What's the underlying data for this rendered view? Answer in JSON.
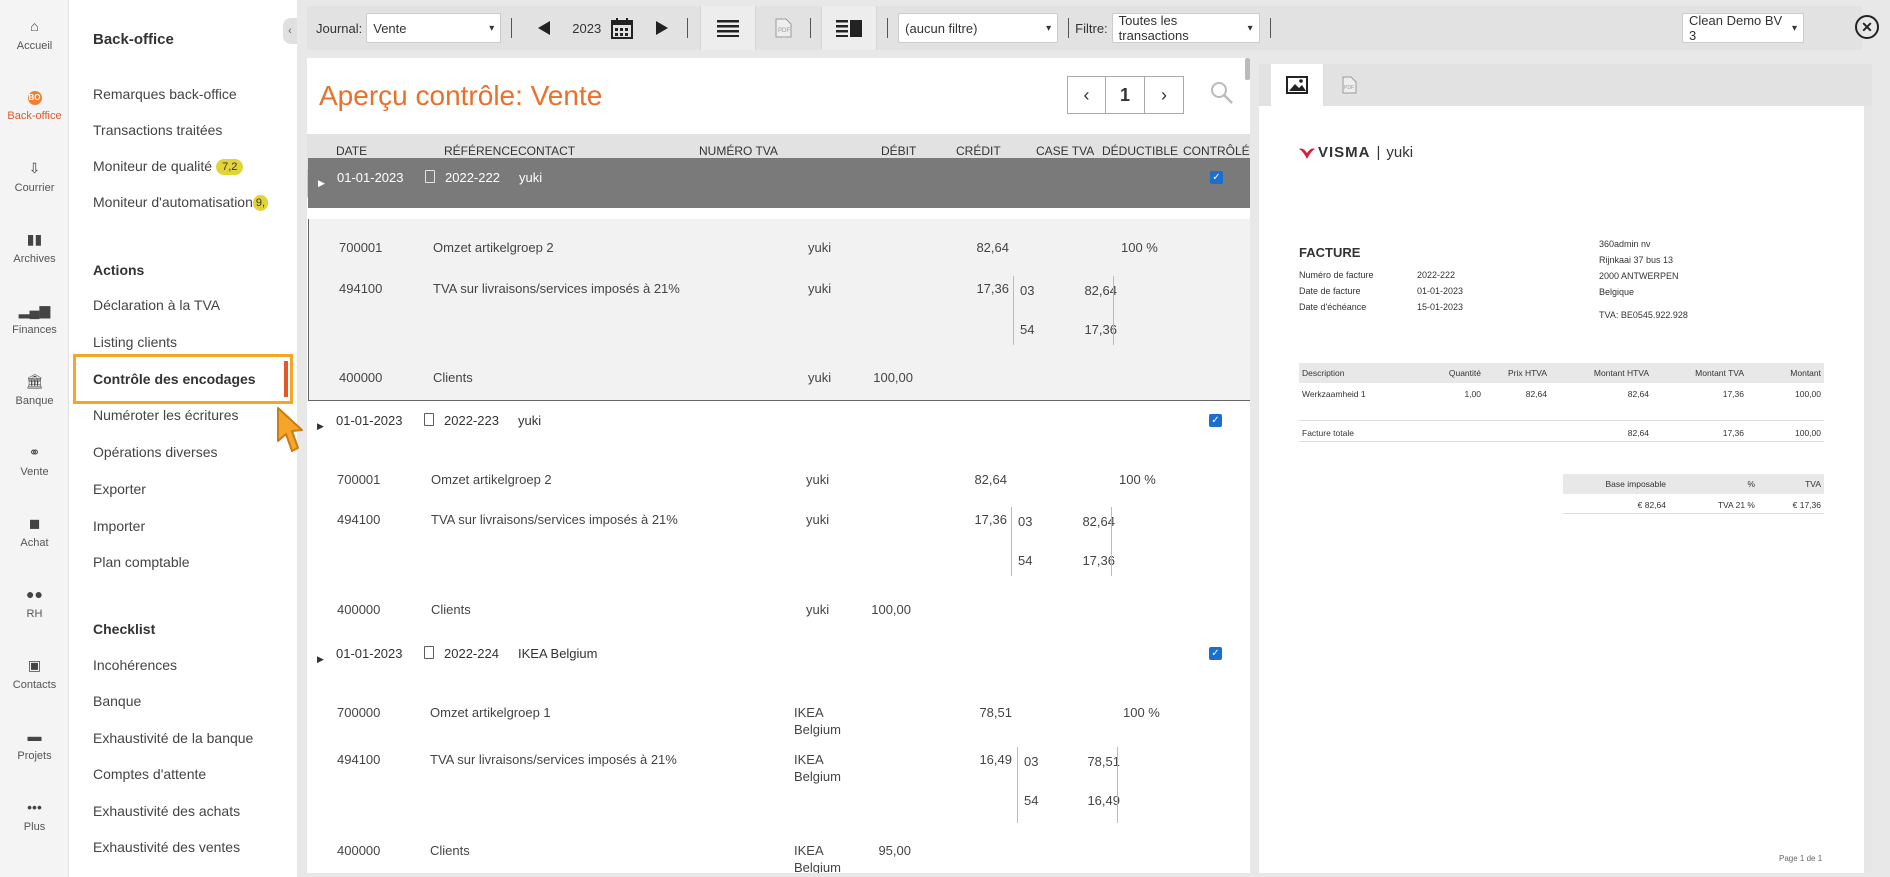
{
  "rail": {
    "items": [
      {
        "label": "Accueil",
        "icon": "home-icon"
      },
      {
        "label": "Back-office",
        "icon": "backoffice-icon",
        "active": true
      },
      {
        "label": "Courrier",
        "icon": "mail-icon"
      },
      {
        "label": "Archives",
        "icon": "archive-icon"
      },
      {
        "label": "Finances",
        "icon": "chart-icon"
      },
      {
        "label": "Banque",
        "icon": "bank-icon"
      },
      {
        "label": "Vente",
        "icon": "handshake-icon"
      },
      {
        "label": "Achat",
        "icon": "truck-icon"
      },
      {
        "label": "RH",
        "icon": "people-icon"
      },
      {
        "label": "Contacts",
        "icon": "contacts-icon"
      },
      {
        "label": "Projets",
        "icon": "folder-icon"
      },
      {
        "label": "Plus",
        "icon": "more-icon"
      }
    ],
    "active_badge": "BO"
  },
  "nav": {
    "title": "Back-office",
    "items1": [
      "Remarques back-office",
      "Transactions traitées"
    ],
    "quality": {
      "label": "Moniteur de qualité",
      "badge": "7,2"
    },
    "automation": {
      "label": "Moniteur d'automatisation",
      "badge": "9,"
    },
    "actions_title": "Actions",
    "actions": [
      "Déclaration à la TVA",
      "Listing clients",
      "Contrôle des encodages",
      "Numéroter les écritures",
      "Opérations diverses",
      "Exporter",
      "Importer",
      "Plan comptable"
    ],
    "checklist_title": "Checklist",
    "checklist": [
      "Incohérences",
      "Banque",
      "Exhaustivité de la banque",
      "Comptes d'attente",
      "Exhaustivité des achats",
      "Exhaustivité des ventes"
    ]
  },
  "toolbar": {
    "journal_label": "Journal:",
    "journal_value": "Vente",
    "year": "2023",
    "filter_value": "(aucun filtre)",
    "filtre_label": "Filtre:",
    "filtre_value": "Toutes les transactions",
    "company": "Clean Demo BV 3"
  },
  "main": {
    "title": "Aperçu contrôle: Vente",
    "page": "1",
    "columns": [
      "DATE",
      "RÉFÉRENCE",
      "CONTACT",
      "NUMÉRO TVA",
      "DÉBIT",
      "CRÉDIT",
      "CASE TVA",
      "DÉDUCTIBLE",
      "CONTRÔLÉ"
    ],
    "groups": [
      {
        "date": "01-01-2023",
        "ref": "2022-222",
        "contact": "yuki",
        "checked": true,
        "lines": [
          {
            "acct": "700001",
            "desc": "Omzet artikelgroep 2",
            "contact": "yuki",
            "debit": "",
            "credit": "82,64",
            "vat": [],
            "deductible": "100 %"
          },
          {
            "acct": "494100",
            "desc": "TVA sur livraisons/services imposés à 21%",
            "contact": "yuki",
            "debit": "",
            "credit": "17,36",
            "vat": [
              {
                "case": "03",
                "amt": "82,64"
              },
              {
                "case": "54",
                "amt": "17,36"
              }
            ],
            "deductible": ""
          },
          {
            "acct": "400000",
            "desc": "Clients",
            "contact": "yuki",
            "debit": "100,00",
            "credit": "",
            "vat": [],
            "deductible": ""
          }
        ]
      },
      {
        "date": "01-01-2023",
        "ref": "2022-223",
        "contact": "yuki",
        "checked": true,
        "lines": [
          {
            "acct": "700001",
            "desc": "Omzet artikelgroep 2",
            "contact": "yuki",
            "debit": "",
            "credit": "82,64",
            "vat": [],
            "deductible": "100 %"
          },
          {
            "acct": "494100",
            "desc": "TVA sur livraisons/services imposés à 21%",
            "contact": "yuki",
            "debit": "",
            "credit": "17,36",
            "vat": [
              {
                "case": "03",
                "amt": "82,64"
              },
              {
                "case": "54",
                "amt": "17,36"
              }
            ],
            "deductible": ""
          },
          {
            "acct": "400000",
            "desc": "Clients",
            "contact": "yuki",
            "debit": "100,00",
            "credit": "",
            "vat": [],
            "deductible": ""
          }
        ]
      },
      {
        "date": "01-01-2023",
        "ref": "2022-224",
        "contact": "IKEA Belgium",
        "checked": true,
        "lines": [
          {
            "acct": "700000",
            "desc": "Omzet artikelgroep 1",
            "contact": "IKEA Belgium",
            "debit": "",
            "credit": "78,51",
            "vat": [],
            "deductible": "100 %"
          },
          {
            "acct": "494100",
            "desc": "TVA sur livraisons/services imposés à 21%",
            "contact": "IKEA Belgium",
            "debit": "",
            "credit": "16,49",
            "vat": [
              {
                "case": "03",
                "amt": "78,51"
              },
              {
                "case": "54",
                "amt": "16,49"
              }
            ],
            "deductible": ""
          },
          {
            "acct": "400000",
            "desc": "Clients",
            "contact": "IKEA Belgium",
            "debit": "95,00",
            "credit": "",
            "vat": [],
            "deductible": ""
          }
        ]
      }
    ]
  },
  "invoice": {
    "brand": "VISMA",
    "product": "yuki",
    "title": "FACTURE",
    "meta": [
      {
        "k": "Numéro de facture",
        "v": "2022-222"
      },
      {
        "k": "Date de facture",
        "v": "01-01-2023"
      },
      {
        "k": "Date d'échéance",
        "v": "15-01-2023"
      }
    ],
    "address": [
      "360admin nv",
      "Rijnkaai 37 bus 13",
      "2000 ANTWERPEN",
      "Belgique"
    ],
    "vat_number": "TVA: BE0545.922.928",
    "table_headers": [
      "Description",
      "Quantité",
      "Prix HTVA",
      "Montant HTVA",
      "Montant TVA",
      "Montant"
    ],
    "table_rows": [
      [
        "Werkzaamheid 1",
        "1,00",
        "82,64",
        "82,64",
        "17,36",
        "100,00"
      ],
      [
        "Facture totale",
        "",
        "",
        "82,64",
        "17,36",
        "100,00"
      ]
    ],
    "summary_headers": [
      "Base imposable",
      "%",
      "TVA"
    ],
    "summary_row": [
      "€ 82,64",
      "TVA 21 %",
      "€ 17,36"
    ],
    "page_label": "Page 1 de 1"
  },
  "colors": {
    "accent": "#e8702a",
    "highlight": "#f4a52a",
    "selected_row": "#7a7a7a",
    "checkbox": "#1a6fcf"
  }
}
